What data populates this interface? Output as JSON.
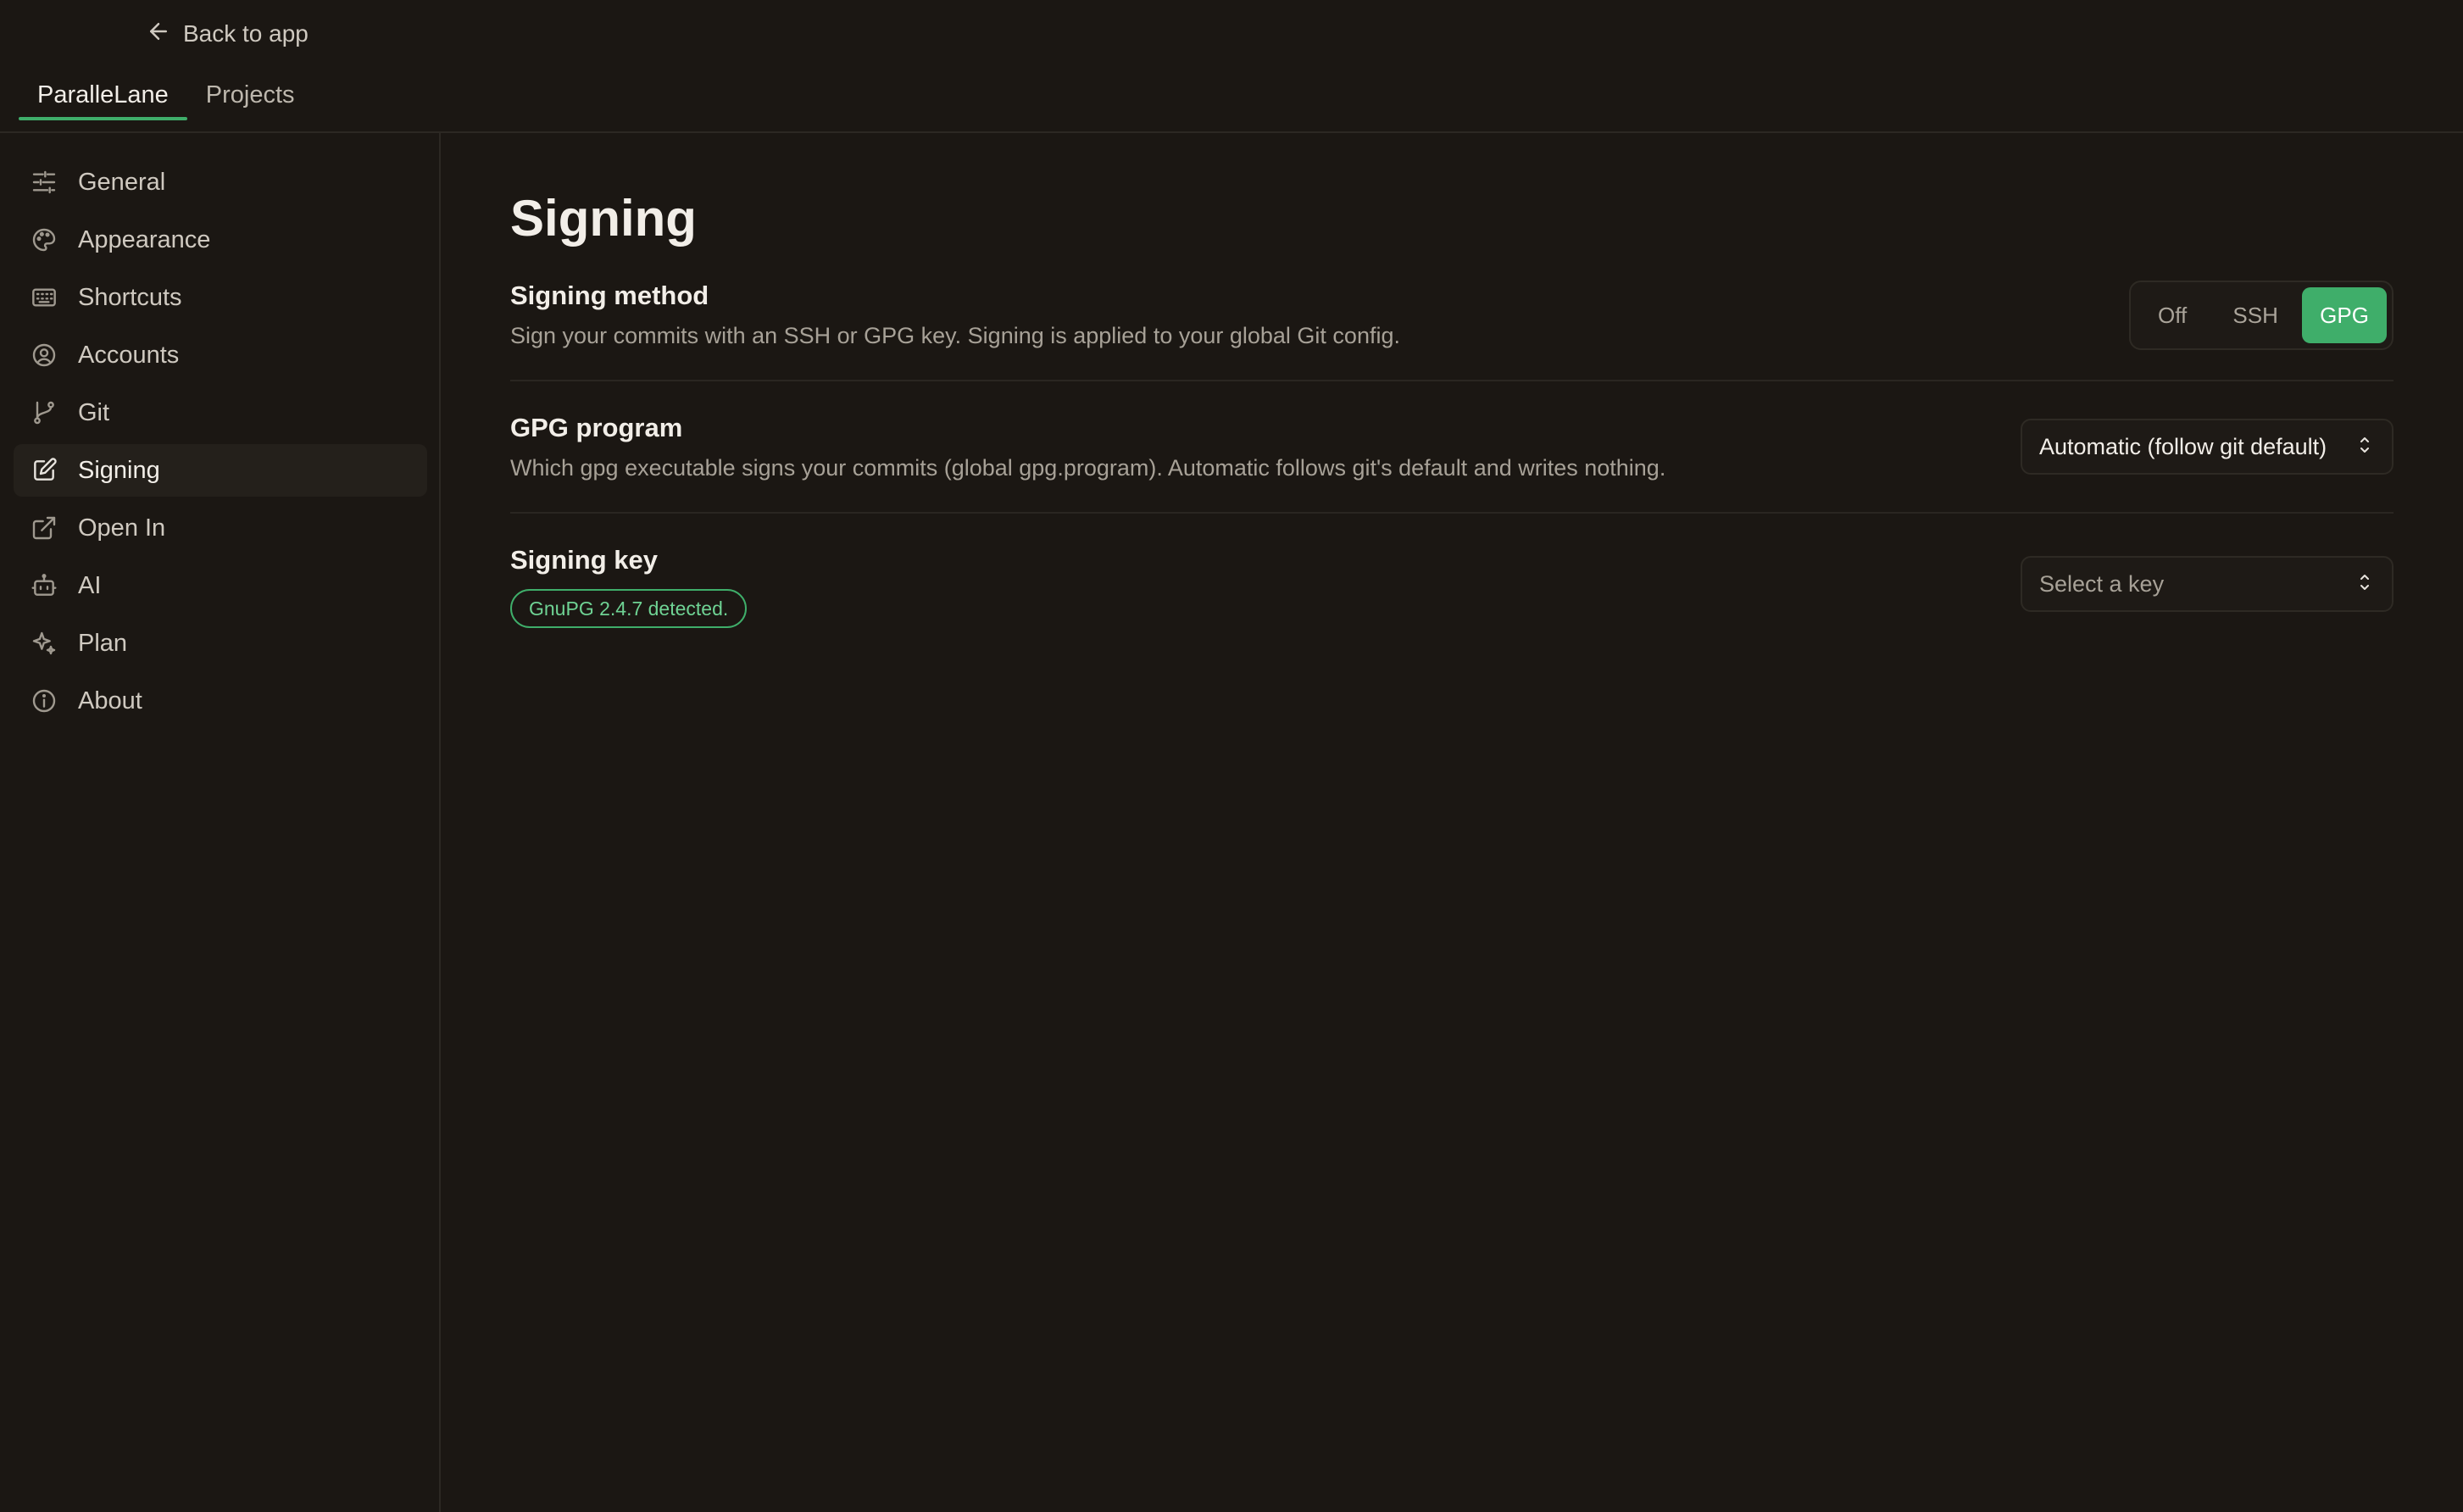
{
  "header": {
    "back_label": "Back to app",
    "tabs": [
      {
        "label": "ParalleLane",
        "active": true
      },
      {
        "label": "Projects",
        "active": false
      }
    ]
  },
  "sidebar": {
    "items": [
      {
        "label": "General",
        "icon": "sliders-icon"
      },
      {
        "label": "Appearance",
        "icon": "palette-icon"
      },
      {
        "label": "Shortcuts",
        "icon": "keyboard-icon"
      },
      {
        "label": "Accounts",
        "icon": "user-circle-icon"
      },
      {
        "label": "Git",
        "icon": "git-branch-icon"
      },
      {
        "label": "Signing",
        "icon": "edit-icon",
        "active": true
      },
      {
        "label": "Open In",
        "icon": "external-link-icon"
      },
      {
        "label": "AI",
        "icon": "bot-icon"
      },
      {
        "label": "Plan",
        "icon": "sparkles-icon"
      },
      {
        "label": "About",
        "icon": "info-icon"
      }
    ]
  },
  "main": {
    "title": "Signing",
    "signing_method": {
      "title": "Signing method",
      "description": "Sign your commits with an SSH or GPG key. Signing is applied to your global Git config.",
      "options": [
        "Off",
        "SSH",
        "GPG"
      ],
      "selected": "GPG"
    },
    "gpg_program": {
      "title": "GPG program",
      "description": "Which gpg executable signs your commits (global gpg.program). Automatic follows git's default and writes nothing.",
      "selected_value": "Automatic (follow git default)"
    },
    "signing_key": {
      "title": "Signing key",
      "badge": "GnuPG 2.4.7 detected.",
      "placeholder": "Select a key"
    }
  },
  "colors": {
    "background": "#1b1713",
    "accent": "#3fae6a",
    "badge_text": "#6fd394"
  }
}
